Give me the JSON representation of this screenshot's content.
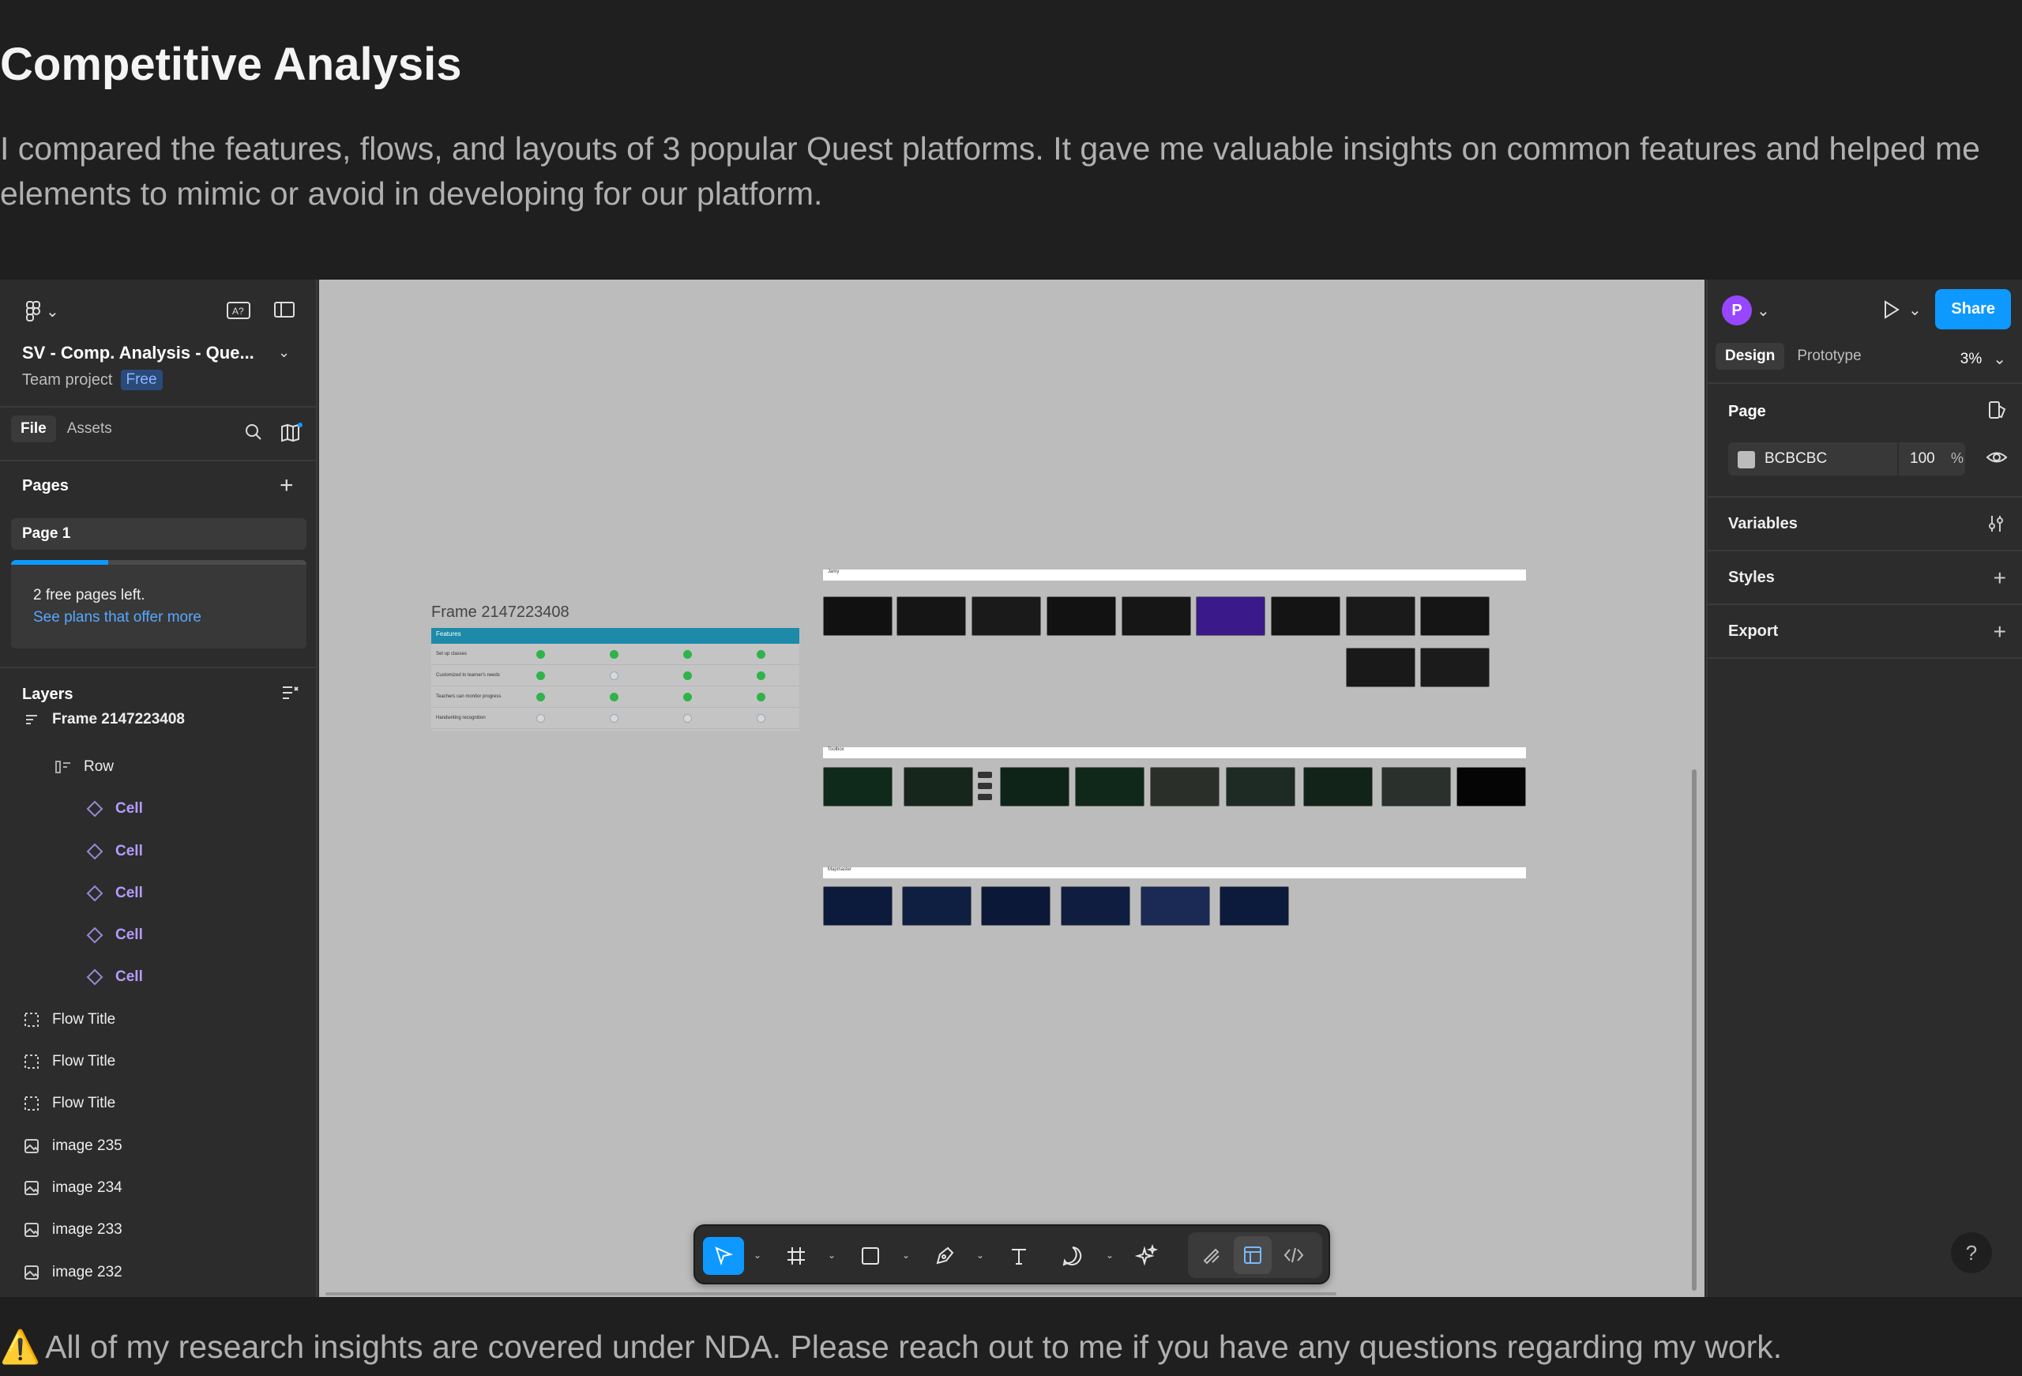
{
  "page": {
    "heading": "Competitive Analysis",
    "intro": "I compared the features, flows, and layouts of 3 popular Quest platforms. It gave me valuable insights on common features and helped me elements to mimic or avoid in developing for our platform.",
    "nda_icon": "⚠️",
    "nda": "All of my research insights are covered under NDA. Please reach out to me if you have any questions regarding my work."
  },
  "left_panel": {
    "file_name": "SV - Comp. Analysis - Que...",
    "project": "Team project",
    "plan_badge": "Free",
    "tabs": [
      "File",
      "Assets"
    ],
    "pages_title": "Pages",
    "pages": [
      "Page 1"
    ],
    "free_pages_text": "2 free pages left.",
    "see_plans_link": "See plans that offer more",
    "free_pages_progress": 0.33,
    "layers_title": "Layers",
    "layers": [
      {
        "name": "Frame 2147223408",
        "icon": "frame-icon"
      },
      {
        "name": "Row",
        "icon": "row-icon"
      },
      {
        "name": "Cell",
        "icon": "component-instance-icon"
      },
      {
        "name": "Cell",
        "icon": "component-instance-icon"
      },
      {
        "name": "Cell",
        "icon": "component-instance-icon"
      },
      {
        "name": "Cell",
        "icon": "component-instance-icon"
      },
      {
        "name": "Cell",
        "icon": "component-instance-icon"
      },
      {
        "name": "Flow Title",
        "icon": "section-icon"
      },
      {
        "name": "Flow Title",
        "icon": "section-icon"
      },
      {
        "name": "Flow Title",
        "icon": "section-icon"
      },
      {
        "name": "image 235",
        "icon": "image-icon"
      },
      {
        "name": "image 234",
        "icon": "image-icon"
      },
      {
        "name": "image 233",
        "icon": "image-icon"
      },
      {
        "name": "image 232",
        "icon": "image-icon"
      }
    ]
  },
  "canvas": {
    "background": "#BCBCBC",
    "frame_label": "Frame 2147223408",
    "table_header": "Features",
    "table_rows": [
      {
        "label": "Set up classes",
        "checks": [
          "g",
          "g",
          "g",
          "g"
        ]
      },
      {
        "label": "Customized to learner's needs",
        "checks": [
          "g",
          "e",
          "g",
          "g"
        ]
      },
      {
        "label": "Teachers can monitor progress",
        "checks": [
          "g",
          "g",
          "g",
          "g"
        ]
      },
      {
        "label": "Handwriting recognition",
        "checks": [
          "e",
          "e",
          "e",
          "e"
        ]
      }
    ],
    "flow_titles": [
      "Jamy",
      "Toolbox",
      "Mapmaster"
    ]
  },
  "toolbar": {
    "tools": [
      "move-tool",
      "frame-tool",
      "shape-tool",
      "pen-tool",
      "text-tool",
      "comment-tool",
      "actions-tool"
    ],
    "mode_tools": [
      "draw-mode",
      "design-mode",
      "dev-mode"
    ]
  },
  "right_panel": {
    "avatar_initial": "P",
    "share_label": "Share",
    "tabs": [
      "Design",
      "Prototype"
    ],
    "zoom": "3%",
    "page_section": "Page",
    "page_color": "BCBCBC",
    "page_opacity": "100",
    "opacity_unit": "%",
    "sections": [
      "Variables",
      "Styles",
      "Export"
    ],
    "help": "?"
  },
  "colors": {
    "accent": "#0d99ff",
    "avatar": "#9747ff",
    "component": "#b49cff"
  }
}
